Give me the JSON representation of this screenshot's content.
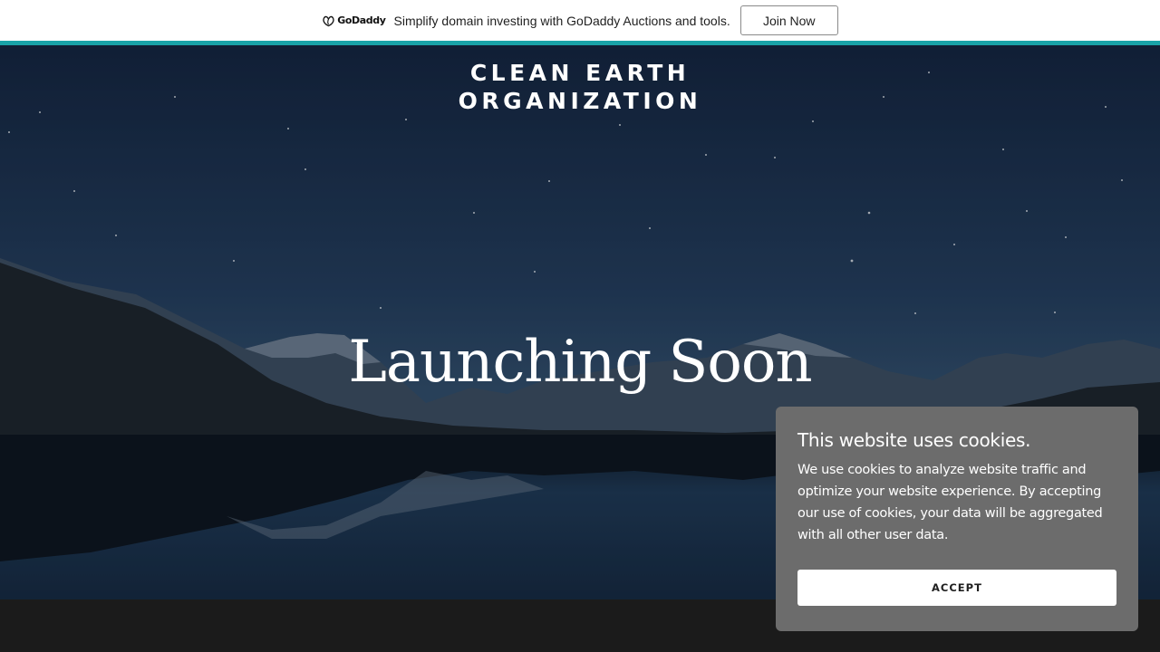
{
  "promo": {
    "logo_text": "GoDaddy",
    "logo_icon": "godaddy-logo-icon",
    "message": "Simplify domain investing with GoDaddy Auctions and tools.",
    "join_label": "Join Now"
  },
  "hero": {
    "site_title": "CLEAN EARTH ORGANIZATION",
    "headline": "Launching Soon",
    "background_image": "starry-night-mountain-lake"
  },
  "cookie": {
    "title": "This website uses cookies.",
    "body": "We use cookies to analyze website traffic and optimize your website experience. By accepting our use of cookies, your data will be aggregated with all other user data.",
    "accept_label": "ACCEPT"
  },
  "colors": {
    "accent": "#19a3a8",
    "cookie_panel": "#6c6c6c",
    "footer": "#1b1b1b"
  }
}
